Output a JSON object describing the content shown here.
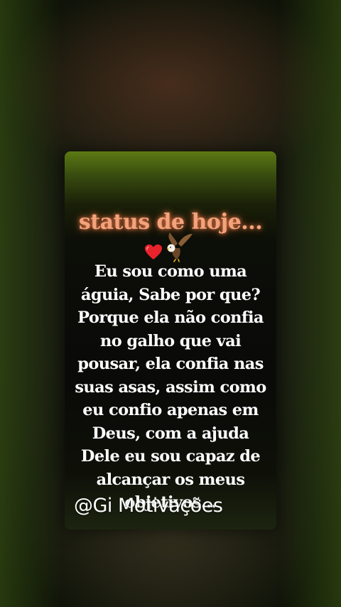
{
  "card": {
    "title": "status de hoje...",
    "emojis": [
      "heart-icon",
      "eagle-icon"
    ],
    "message": "Eu sou como uma\náguia, Sabe por que?\nPorque ela não confia\nno galho que vai\npousar, ela confia nas\nsuas asas, assim como\neu confio apenas em\nDeus, com a ajuda\nDele eu sou capaz de\nalcançar os meus\nobjetivos..."
  },
  "watermark": {
    "text": "@Gi Motivações"
  },
  "colors": {
    "title": "#f3a37c",
    "text": "#ffffff",
    "card_top": "#5c7a12"
  }
}
